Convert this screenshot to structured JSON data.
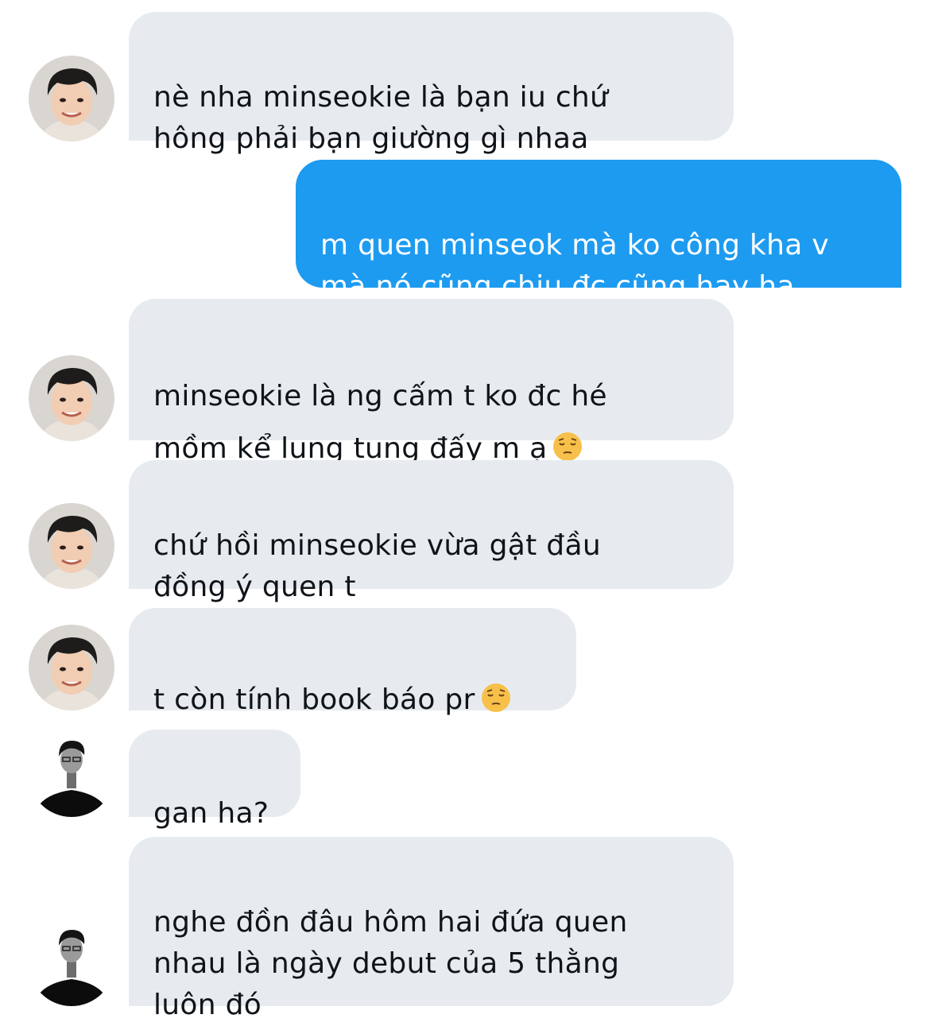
{
  "messages": [
    {
      "sender": "other",
      "avatar": "avatar-minseok",
      "text": "nè nha minseokie là bạn iu chứ\nhông phải bạn giường gì nhaa"
    },
    {
      "sender": "self",
      "text": "m quen minseok mà ko công kha v\nmà nó cũng chịu đc cũng hay ha"
    },
    {
      "sender": "other",
      "avatar": "avatar-minseok",
      "text": "minseokie là ng cấm t ko đc hé\nmồm kể lung tung đấy m ạ",
      "emoji": "pensive-face-emoji"
    },
    {
      "sender": "other",
      "avatar": "avatar-minseok",
      "text": "chứ hồi minseokie vừa gật đầu\nđồng ý quen t"
    },
    {
      "sender": "other",
      "avatar": "avatar-minseok",
      "text": "t còn tính book báo pr",
      "emoji": "pensive-face-emoji"
    },
    {
      "sender": "other",
      "avatar": "avatar-bw-man",
      "text": "gan ha?"
    },
    {
      "sender": "other",
      "avatar": "avatar-bw-man",
      "text": "nghe đồn đâu hôm hai đứa quen\nnhau là ngày debut của 5 thằng\nluôn đó"
    }
  ],
  "colors": {
    "incoming_bubble": "#e7ebef",
    "outgoing_bubble": "#1d9bf0",
    "incoming_text": "#0f1419",
    "outgoing_text": "#ffffff",
    "background": "#ffffff"
  }
}
